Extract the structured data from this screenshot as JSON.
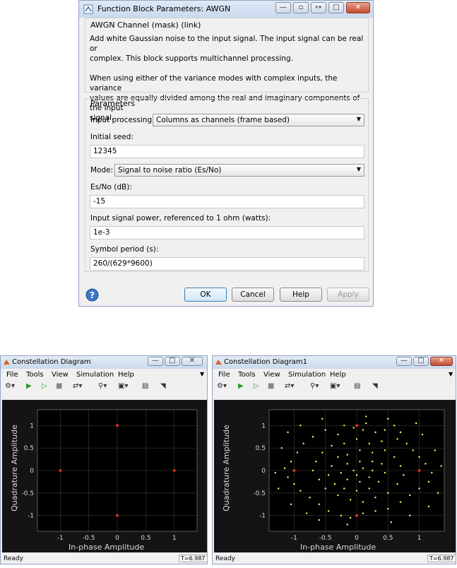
{
  "dialog": {
    "title": "Function Block Parameters: AWGN",
    "mask_title": "AWGN Channel (mask) (link)",
    "desc1_line1": "Add white Gaussian noise to the input signal. The input signal can be real or",
    "desc1_line2": "complex. This block supports multichannel processing.",
    "desc2_line1": "When using either of the variance modes with complex inputs, the variance",
    "desc2_line2": "values are equally divided among the real and imaginary components of the input",
    "desc2_line3": "signal.",
    "params_title": "Parameters",
    "input_processing_label": "Input processing:",
    "input_processing_value": "Columns as channels (frame based)",
    "initial_seed_label": "Initial seed:",
    "initial_seed_value": "12345",
    "mode_label": "Mode:",
    "mode_value": "Signal to noise ratio  (Es/No)",
    "esno_label": "Es/No (dB):",
    "esno_value": "-15",
    "power_label": "Input signal power, referenced to 1 ohm (watts):",
    "power_value": "1e-3",
    "symbol_period_label": "Symbol period (s):",
    "symbol_period_value": "260/(629*9600)",
    "ok_label": "OK",
    "cancel_label": "Cancel",
    "help_label": "Help",
    "apply_label": "Apply"
  },
  "scopes": [
    {
      "title": "Constellation Diagram",
      "menu": [
        "File",
        "Tools",
        "View",
        "Simulation",
        "Help"
      ],
      "xlabel": "In-phase Amplitude",
      "ylabel": "Quadrature Amplitude",
      "status": "Ready",
      "time": "T=6.987"
    },
    {
      "title": "Constellation Diagram1",
      "menu": [
        "File",
        "Tools",
        "View",
        "Simulation",
        "Help"
      ],
      "xlabel": "In-phase Amplitude",
      "ylabel": "Quadrature Amplitude",
      "status": "Ready",
      "time": "T=6.987"
    }
  ],
  "chart_data": [
    {
      "type": "scatter",
      "title": "",
      "xlabel": "In-phase Amplitude",
      "ylabel": "Quadrature Amplitude",
      "xlim": [
        -1.4,
        1.4
      ],
      "ylim": [
        -1.35,
        1.35
      ],
      "xticks": [
        -1,
        -0.5,
        0,
        0.5,
        1
      ],
      "yticks": [
        -1,
        -0.5,
        0,
        0.5,
        1
      ],
      "tick_labels_x": [
        "-1",
        "-0.5",
        "0",
        "0.5",
        "1"
      ],
      "tick_labels_y": [
        "-1",
        "-0.5",
        "0",
        "0.5",
        "1"
      ],
      "grid": true,
      "reference_points": [
        [
          1,
          0
        ],
        [
          0,
          1
        ],
        [
          -1,
          0
        ],
        [
          0,
          -1
        ]
      ],
      "received_points": [
        [
          1,
          0
        ],
        [
          0,
          1
        ],
        [
          -1,
          0
        ],
        [
          0,
          -1
        ]
      ],
      "colors": {
        "received": "#ffff66",
        "reference": "#ff3b1f"
      }
    },
    {
      "type": "scatter",
      "title": "",
      "xlabel": "In-phase Amplitude",
      "ylabel": "Quadrature Amplitude",
      "xlim": [
        -1.4,
        1.4
      ],
      "ylim": [
        -1.35,
        1.35
      ],
      "xticks": [
        -1,
        -0.5,
        0,
        0.5,
        1
      ],
      "yticks": [
        -1,
        -0.5,
        0,
        0.5,
        1
      ],
      "tick_labels_x": [
        "-1",
        "-0.5",
        "0",
        "0.5",
        "1"
      ],
      "tick_labels_y": [
        "-1",
        "-0.5",
        "0",
        "0.5",
        "1"
      ],
      "grid": true,
      "reference_points": [
        [
          1,
          0
        ],
        [
          0,
          1
        ],
        [
          -1,
          0
        ],
        [
          0,
          -1
        ]
      ],
      "received_points": [
        [
          -0.05,
          0.95
        ],
        [
          0.1,
          0.9
        ],
        [
          0.15,
          1.05
        ],
        [
          -0.2,
          1.0
        ],
        [
          0.3,
          0.85
        ],
        [
          -0.3,
          0.8
        ],
        [
          0.45,
          0.9
        ],
        [
          0.6,
          1.0
        ],
        [
          0.7,
          0.85
        ],
        [
          -0.5,
          0.9
        ],
        [
          -0.7,
          0.75
        ],
        [
          -0.85,
          0.6
        ],
        [
          -0.95,
          0.4
        ],
        [
          -1.05,
          0.2
        ],
        [
          -1.15,
          0.05
        ],
        [
          -1.1,
          -0.15
        ],
        [
          -1.0,
          -0.3
        ],
        [
          -0.9,
          -0.45
        ],
        [
          -0.75,
          -0.6
        ],
        [
          -0.6,
          -0.75
        ],
        [
          -0.45,
          -0.9
        ],
        [
          -0.25,
          -1.0
        ],
        [
          -0.1,
          -1.05
        ],
        [
          0.1,
          -0.95
        ],
        [
          0.3,
          -0.9
        ],
        [
          0.5,
          -0.85
        ],
        [
          0.7,
          -0.7
        ],
        [
          0.85,
          -0.55
        ],
        [
          1.0,
          -0.4
        ],
        [
          1.15,
          -0.25
        ],
        [
          1.2,
          -0.05
        ],
        [
          1.1,
          0.15
        ],
        [
          1.0,
          0.3
        ],
        [
          0.9,
          0.45
        ],
        [
          0.8,
          0.6
        ],
        [
          0.65,
          0.7
        ],
        [
          0.4,
          0.65
        ],
        [
          0.2,
          0.6
        ],
        [
          0.0,
          0.7
        ],
        [
          -0.2,
          0.6
        ],
        [
          -0.4,
          0.55
        ],
        [
          -0.55,
          0.4
        ],
        [
          -0.65,
          0.2
        ],
        [
          -0.7,
          0.0
        ],
        [
          -0.6,
          -0.2
        ],
        [
          -0.5,
          -0.4
        ],
        [
          -0.3,
          -0.55
        ],
        [
          -0.1,
          -0.65
        ],
        [
          0.1,
          -0.7
        ],
        [
          0.3,
          -0.6
        ],
        [
          0.5,
          -0.5
        ],
        [
          0.65,
          -0.3
        ],
        [
          0.75,
          -0.1
        ],
        [
          0.7,
          0.1
        ],
        [
          0.6,
          0.3
        ],
        [
          0.45,
          0.45
        ],
        [
          0.25,
          0.4
        ],
        [
          0.05,
          0.45
        ],
        [
          -0.15,
          0.35
        ],
        [
          -0.3,
          0.3
        ],
        [
          -0.4,
          0.1
        ],
        [
          -0.45,
          -0.1
        ],
        [
          -0.35,
          -0.3
        ],
        [
          -0.2,
          -0.4
        ],
        [
          0.0,
          -0.45
        ],
        [
          0.2,
          -0.4
        ],
        [
          0.35,
          -0.25
        ],
        [
          0.45,
          -0.05
        ],
        [
          0.4,
          0.15
        ],
        [
          0.25,
          0.2
        ],
        [
          0.05,
          0.2
        ],
        [
          -0.15,
          0.15
        ],
        [
          -0.25,
          -0.05
        ],
        [
          -0.15,
          -0.2
        ],
        [
          0.05,
          -0.25
        ],
        [
          0.2,
          -0.15
        ],
        [
          0.25,
          0.0
        ],
        [
          0.1,
          0.05
        ],
        [
          -0.05,
          0.0
        ],
        [
          0.0,
          -0.1
        ],
        [
          -1.2,
          0.5
        ],
        [
          -1.25,
          -0.4
        ],
        [
          1.25,
          0.45
        ],
        [
          1.3,
          -0.5
        ],
        [
          -0.9,
          1.0
        ],
        [
          0.95,
          1.05
        ],
        [
          -0.8,
          -0.95
        ],
        [
          0.85,
          -1.0
        ],
        [
          -0.55,
          1.15
        ],
        [
          0.5,
          1.15
        ],
        [
          -0.6,
          -1.1
        ],
        [
          0.55,
          -1.15
        ],
        [
          1.05,
          0.8
        ],
        [
          -1.05,
          -0.75
        ],
        [
          1.15,
          -0.8
        ],
        [
          -1.1,
          0.85
        ],
        [
          0.15,
          1.2
        ],
        [
          -0.15,
          -1.2
        ],
        [
          1.35,
          0.1
        ],
        [
          -1.3,
          -0.05
        ]
      ],
      "colors": {
        "received": "#ffff66",
        "reference": "#ff3b1f"
      }
    }
  ]
}
